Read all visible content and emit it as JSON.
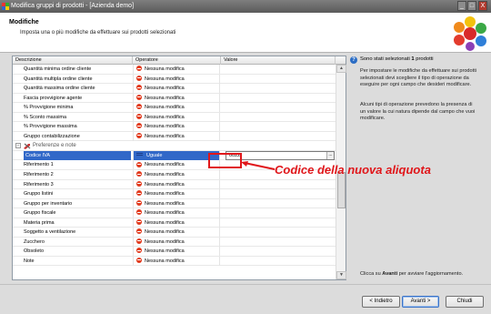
{
  "window": {
    "title": "Modifica gruppi di prodotti - [Azienda demo]",
    "min": "_",
    "max": "□",
    "close": "X"
  },
  "header": {
    "title": "Modifiche",
    "subtitle": "Imposta una o più modifiche da effettuare sui prodotti selezionati"
  },
  "grid": {
    "columns": [
      "Descrizione",
      "Operatore",
      "Valore"
    ],
    "rows_top": [
      {
        "desc": "Quantità minima ordine cliente",
        "op": "Nessuna modifica",
        "val": ""
      },
      {
        "desc": "Quantità multipla ordine cliente",
        "op": "Nessuna modifica",
        "val": ""
      },
      {
        "desc": "Quantità massima ordine cliente",
        "op": "Nessuna modifica",
        "val": ""
      },
      {
        "desc": "Fascia provvigione agente",
        "op": "Nessuna modifica",
        "val": ""
      },
      {
        "desc": "% Provvigione minima",
        "op": "Nessuna modifica",
        "val": ""
      },
      {
        "desc": "% Sconto massima",
        "op": "Nessuna modifica",
        "val": ""
      },
      {
        "desc": "% Provvigione massima",
        "op": "Nessuna modifica",
        "val": ""
      },
      {
        "desc": "Gruppo contabilizzazione",
        "op": "Nessuna modifica",
        "val": ""
      }
    ],
    "group": {
      "label": "Preferenze e note",
      "toggle": "−"
    },
    "selected_row": {
      "desc": "Codice IVA",
      "op": "Uguale",
      "val": "0022",
      "ellipsis": "..."
    },
    "rows_bottom": [
      {
        "desc": "Riferimento 1",
        "op": "Nessuna modifica",
        "val": ""
      },
      {
        "desc": "Riferimento 2",
        "op": "Nessuna modifica",
        "val": ""
      },
      {
        "desc": "Riferimento 3",
        "op": "Nessuna modifica",
        "val": ""
      },
      {
        "desc": "Gruppo listini",
        "op": "Nessuna modifica",
        "val": ""
      },
      {
        "desc": "Gruppo per inventario",
        "op": "Nessuna modifica",
        "val": ""
      },
      {
        "desc": "Gruppo fiscale",
        "op": "Nessuna modifica",
        "val": ""
      },
      {
        "desc": "Materia prima",
        "op": "Nessuna modifica",
        "val": ""
      },
      {
        "desc": "Soggetto a ventilazione",
        "op": "Nessuna modifica",
        "val": ""
      },
      {
        "desc": "Zucchero",
        "op": "Nessuna modifica",
        "val": ""
      },
      {
        "desc": "Obsoleto",
        "op": "Nessuna modifica",
        "val": ""
      },
      {
        "desc": "Note",
        "op": "Nessuna modifica",
        "val": ""
      }
    ]
  },
  "callout": {
    "text": "Codice della nuova aliquota",
    "color": "#e0161a"
  },
  "side": {
    "selected_prefix": "Sono stati selezionati ",
    "selected_count": "1",
    "selected_suffix": " prodotti",
    "help1": "Per impostare le modifiche da effettuare sui prodotti selezionati devi scegliere il tipo di operazione da eseguire per ogni campo che desideri modificare.",
    "help2": "Alcuni tipi di operazione prevedono la presenza di un valore la cui natura dipende dal campo che vuoi modificare.",
    "footer_prefix": "Clicca su ",
    "footer_bold": "Avanti",
    "footer_suffix": " per avviare l'aggiornamento."
  },
  "buttons": {
    "back": "< Indietro",
    "next": "Avanti >",
    "close": "Chiudi"
  },
  "colors": {
    "selection": "#3168c8",
    "no_change_icon": "#e23a1d",
    "accent_red": "#e0161a"
  }
}
